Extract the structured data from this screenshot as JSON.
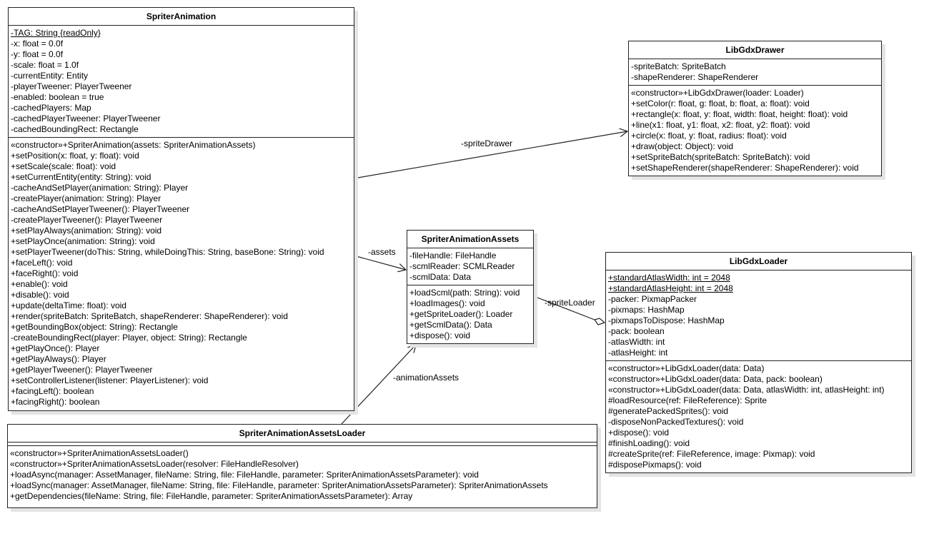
{
  "classes": {
    "spriter_animation": {
      "name": "SpriterAnimation",
      "attributes": [
        {
          "text": "-TAG: String {readOnly}",
          "static": true
        },
        {
          "text": "-x: float = 0.0f"
        },
        {
          "text": "-y: float = 0.0f"
        },
        {
          "text": "-scale: float = 1.0f"
        },
        {
          "text": "-currentEntity: Entity"
        },
        {
          "text": "-playerTweener: PlayerTweener"
        },
        {
          "text": "-enabled: boolean = true"
        },
        {
          "text": "-cachedPlayers: Map"
        },
        {
          "text": "-cachedPlayerTweener: PlayerTweener"
        },
        {
          "text": "-cachedBoundingRect: Rectangle"
        }
      ],
      "operations": [
        {
          "text": "«constructor»+SpriterAnimation(assets: SpriterAnimationAssets)"
        },
        {
          "text": "+setPosition(x: float, y: float): void"
        },
        {
          "text": "+setScale(scale: float): void"
        },
        {
          "text": "+setCurrentEntity(entity: String): void"
        },
        {
          "text": "-cacheAndSetPlayer(animation: String): Player"
        },
        {
          "text": "-createPlayer(animation: String): Player"
        },
        {
          "text": "-cacheAndSetPlayerTweener(): PlayerTweener"
        },
        {
          "text": "-createPlayerTweener(): PlayerTweener"
        },
        {
          "text": "+setPlayAlways(animation: String): void"
        },
        {
          "text": "+setPlayOnce(animation: String): void"
        },
        {
          "text": "+setPlayerTweener(doThis: String, whileDoingThis: String, baseBone: String): void"
        },
        {
          "text": "+faceLeft(): void"
        },
        {
          "text": "+faceRight(): void"
        },
        {
          "text": "+enable(): void"
        },
        {
          "text": "+disable(): void"
        },
        {
          "text": "+update(deltaTime: float): void"
        },
        {
          "text": "+render(spriteBatch: SpriteBatch, shapeRenderer: ShapeRenderer): void"
        },
        {
          "text": "+getBoundingBox(object: String): Rectangle"
        },
        {
          "text": "-createBoundingRect(player: Player, object: String): Rectangle"
        },
        {
          "text": "+getPlayOnce(): Player"
        },
        {
          "text": "+getPlayAlways(): Player"
        },
        {
          "text": "+getPlayerTweener(): PlayerTweener"
        },
        {
          "text": "+setControllerListener(listener: PlayerListener): void"
        },
        {
          "text": "+facingLeft(): boolean"
        },
        {
          "text": "+facingRight(): boolean"
        }
      ]
    },
    "libgdx_drawer": {
      "name": "LibGdxDrawer",
      "attributes": [
        {
          "text": "-spriteBatch: SpriteBatch"
        },
        {
          "text": "-shapeRenderer: ShapeRenderer"
        }
      ],
      "operations": [
        {
          "text": "«constructor»+LibGdxDrawer(loader: Loader)"
        },
        {
          "text": "+setColor(r: float, g: float, b: float, a: float): void"
        },
        {
          "text": "+rectangle(x: float, y: float, width: float, height: float): void"
        },
        {
          "text": "+line(x1: float, y1: float, x2: float, y2: float): void"
        },
        {
          "text": "+circle(x: float, y: float, radius: float): void"
        },
        {
          "text": "+draw(object: Object): void"
        },
        {
          "text": "+setSpriteBatch(spriteBatch: SpriteBatch): void"
        },
        {
          "text": "+setShapeRenderer(shapeRenderer: ShapeRenderer): void"
        }
      ]
    },
    "spriter_animation_assets": {
      "name": "SpriterAnimationAssets",
      "attributes": [
        {
          "text": "-fileHandle: FileHandle"
        },
        {
          "text": "-scmlReader: SCMLReader"
        },
        {
          "text": "-scmlData: Data"
        }
      ],
      "operations": [
        {
          "text": "+loadScml(path: String): void"
        },
        {
          "text": "+loadImages(): void"
        },
        {
          "text": "+getSpriteLoader(): Loader"
        },
        {
          "text": "+getScmlData(): Data"
        },
        {
          "text": "+dispose(): void"
        }
      ]
    },
    "libgdx_loader": {
      "name": "LibGdxLoader",
      "attributes": [
        {
          "text": "+standardAtlasWidth: int = 2048",
          "static": true
        },
        {
          "text": "+standardAtlasHeight: int = 2048",
          "static": true
        },
        {
          "text": "-packer: PixmapPacker"
        },
        {
          "text": "-pixmaps: HashMap"
        },
        {
          "text": "-pixmapsToDispose: HashMap"
        },
        {
          "text": "-pack: boolean"
        },
        {
          "text": "-atlasWidth: int"
        },
        {
          "text": "-atlasHeight: int"
        }
      ],
      "operations": [
        {
          "text": "«constructor»+LibGdxLoader(data: Data)"
        },
        {
          "text": "«constructor»+LibGdxLoader(data: Data, pack: boolean)"
        },
        {
          "text": "«constructor»+LibGdxLoader(data: Data, atlasWidth: int, atlasHeight: int)"
        },
        {
          "text": "#loadResource(ref: FileReference): Sprite"
        },
        {
          "text": "#generatePackedSprites(): void"
        },
        {
          "text": "-disposeNonPackedTextures(): void"
        },
        {
          "text": "+dispose(): void"
        },
        {
          "text": "#finishLoading(): void"
        },
        {
          "text": "#createSprite(ref: FileReference, image: Pixmap): void"
        },
        {
          "text": "#disposePixmaps(): void"
        }
      ]
    },
    "spriter_animation_assets_loader": {
      "name": "SpriterAnimationAssetsLoader",
      "attributes": [],
      "operations": [
        {
          "text": "«constructor»+SpriterAnimationAssetsLoader()"
        },
        {
          "text": "«constructor»+SpriterAnimationAssetsLoader(resolver: FileHandleResolver)"
        },
        {
          "text": "+loadAsync(manager: AssetManager, fileName: String, file: FileHandle, parameter: SpriterAnimationAssetsParameter): void"
        },
        {
          "text": "+loadSync(manager: AssetManager, fileName: String, file: FileHandle, parameter: SpriterAnimationAssetsParameter): SpriterAnimationAssets"
        },
        {
          "text": "+getDependencies(fileName: String, file: FileHandle, parameter: SpriterAnimationAssetsParameter): Array"
        }
      ]
    }
  },
  "relations": {
    "sprite_drawer": "-spriteDrawer",
    "assets": "-assets",
    "sprite_loader": "-spriteLoader",
    "animation_assets": "-animationAssets"
  }
}
